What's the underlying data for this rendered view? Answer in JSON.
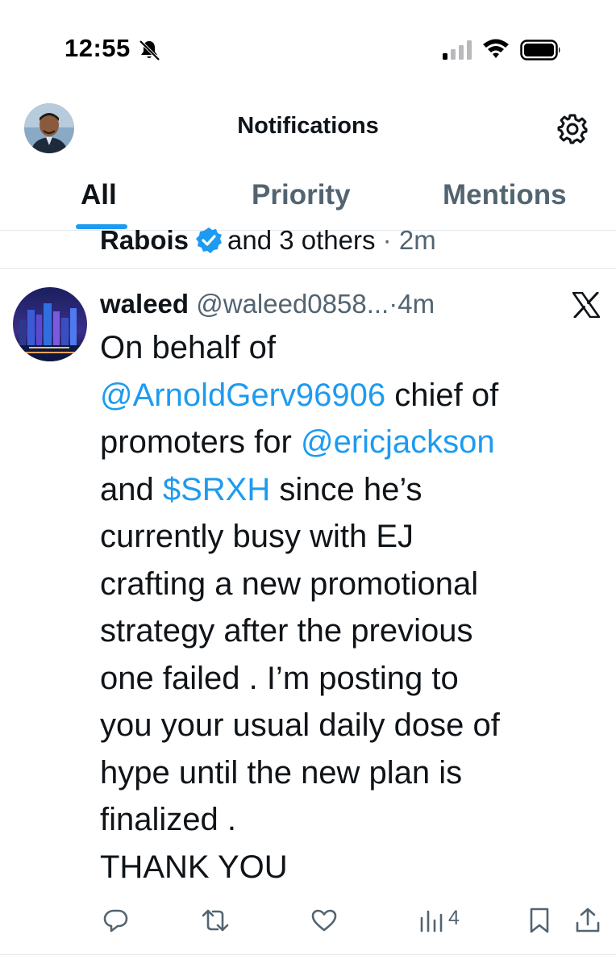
{
  "status_bar": {
    "time": "12:55",
    "icons": [
      "bell-muted-icon",
      "cellular-signal-icon",
      "wifi-icon",
      "battery-icon"
    ]
  },
  "header": {
    "title": "Notifications",
    "avatar": "user-avatar",
    "settings_icon": "gear-icon"
  },
  "tabs": [
    {
      "label": "All",
      "active": true
    },
    {
      "label": "Priority",
      "active": false
    },
    {
      "label": "Mentions",
      "active": false
    }
  ],
  "previous_notification": {
    "name": "Rabois",
    "verified": true,
    "rest": "and 3 others",
    "separator": "·",
    "time": "2m"
  },
  "tweet": {
    "author": "waleed",
    "handle": "@waleed0858...",
    "separator": "·",
    "time": "4m",
    "lines": [
      [
        {
          "text": "On behalf of",
          "link": false
        }
      ],
      [
        {
          "text": "@ArnoldGerv96906",
          "link": true
        },
        {
          "text": " chief of",
          "link": false
        }
      ],
      [
        {
          "text": "promoters for ",
          "link": false
        },
        {
          "text": "@ericjackson",
          "link": true
        }
      ],
      [
        {
          "text": "and ",
          "link": false
        },
        {
          "text": "$SRXH",
          "link": true
        },
        {
          "text": " since he’s",
          "link": false
        }
      ],
      [
        {
          "text": "currently busy with EJ",
          "link": false
        }
      ],
      [
        {
          "text": "crafting a new promotional",
          "link": false
        }
      ],
      [
        {
          "text": "strategy after the previous",
          "link": false
        }
      ],
      [
        {
          "text": "one failed . I’m posting to",
          "link": false
        }
      ],
      [
        {
          "text": "you your usual daily dose of",
          "link": false
        }
      ],
      [
        {
          "text": "hype until the new plan is",
          "link": false
        }
      ],
      [
        {
          "text": "finalized .",
          "link": false
        }
      ],
      [
        {
          "text": "THANK YOU",
          "link": false
        }
      ]
    ],
    "actions": {
      "views_count": "4"
    }
  },
  "colors": {
    "accent": "#1d9bf0",
    "text_primary": "#0f1419",
    "text_secondary": "#536471",
    "divider": "#e1e8ed"
  }
}
